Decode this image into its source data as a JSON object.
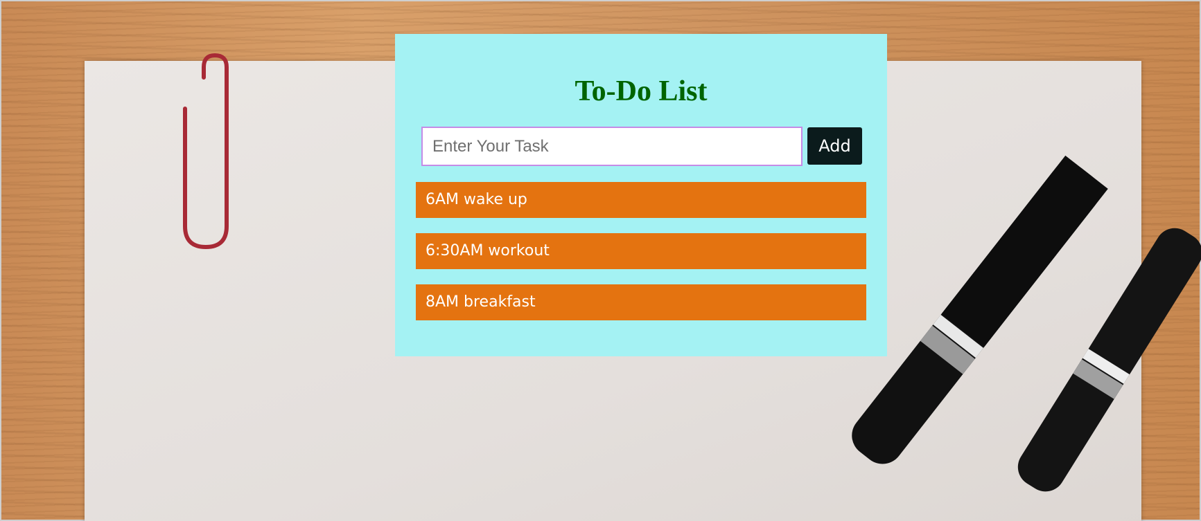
{
  "app": {
    "title": "To-Do List"
  },
  "input": {
    "placeholder": "Enter Your Task",
    "value": ""
  },
  "add_button": {
    "label": "Add"
  },
  "tasks": [
    {
      "label": "6AM wake up"
    },
    {
      "label": "6:30AM workout"
    },
    {
      "label": "8AM breakfast"
    }
  ],
  "colors": {
    "panel_bg": "#a4f2f3",
    "title": "#006400",
    "button_bg": "#0b1b1c",
    "task_bg": "#e47310",
    "input_border": "#c58be6"
  }
}
